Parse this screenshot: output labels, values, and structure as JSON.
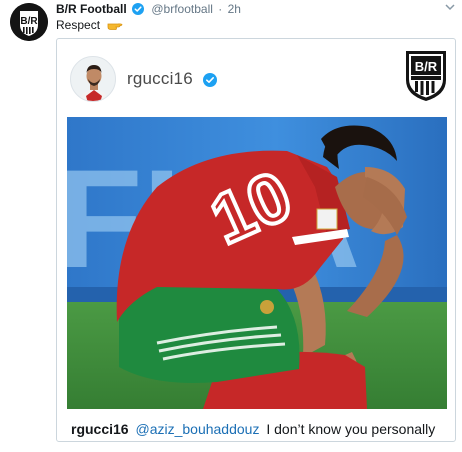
{
  "tweet": {
    "author": "B/R Football",
    "handle": "@brfootball",
    "separator": "·",
    "time": "2h",
    "text": "Respect",
    "emoji_icon": "pointing-hand-icon"
  },
  "embed": {
    "username": "rgucci16",
    "caption": {
      "user": "rgucci16",
      "mention": "@aziz_bouhaddouz",
      "text": "I don’t know you personally"
    }
  },
  "colors": {
    "verified_blue": "#1da1f2",
    "link_blue": "#1b6fb5",
    "pitch_green": "#3e8a3a",
    "jersey_red": "#c62828",
    "shorts_green": "#1f8a3f"
  }
}
